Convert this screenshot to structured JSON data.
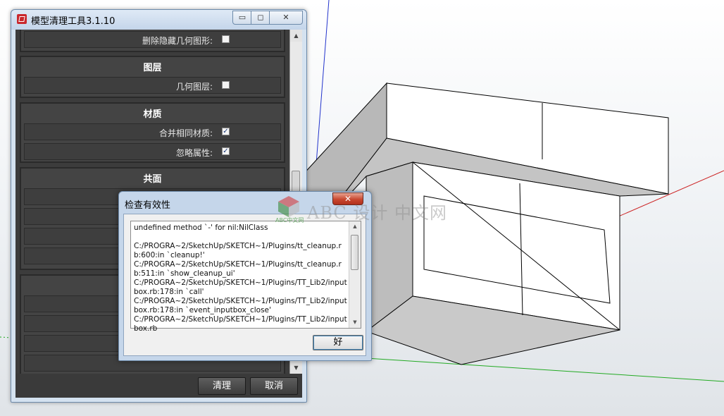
{
  "tool_window": {
    "title": "模型清理工具3.1.10",
    "titlebar_buttons": {
      "minimize": "▭",
      "maximize": "◻",
      "close": "✕"
    },
    "sections": [
      {
        "title": "",
        "rows": [
          {
            "label": "删除隐藏几何图形:",
            "checked": false
          }
        ]
      },
      {
        "title": "图层",
        "rows": [
          {
            "label": "几何图层:",
            "checked": false
          }
        ]
      },
      {
        "title": "材质",
        "rows": [
          {
            "label": "合并相同材质:",
            "checked": true
          },
          {
            "label": "忽略属性:",
            "checked": true
          }
        ]
      },
      {
        "title": "共面",
        "rows": []
      }
    ],
    "buttons": {
      "clean": "清理",
      "cancel": "取消"
    }
  },
  "error_dialog": {
    "title": "检查有效性",
    "close_glyph": "✕",
    "message": "undefined method `-' for nil:NilClass\n\nC:/PROGRA~2/SketchUp/SKETCH~1/Plugins/tt_cleanup.rb:600:in `cleanup!'\nC:/PROGRA~2/SketchUp/SKETCH~1/Plugins/tt_cleanup.rb:511:in `show_cleanup_ui'\nC:/PROGRA~2/SketchUp/SKETCH~1/Plugins/TT_Lib2/inputbox.rb:178:in `call'\nC:/PROGRA~2/SketchUp/SKETCH~1/Plugins/TT_Lib2/inputbox.rb:178:in `event_inputbox_close'\nC:/PROGRA~2/SketchUp/SKETCH~1/Plugins/TT_Lib2/inputbox.rb",
    "ok_label": "好"
  },
  "watermark": {
    "text": "ABC 设计 中文网",
    "small": "ABC中文网"
  },
  "colors": {
    "axis_red": "#cc2222",
    "axis_green": "#22aa22",
    "axis_blue": "#2233cc",
    "panel_dark": "#3c3c3c"
  }
}
